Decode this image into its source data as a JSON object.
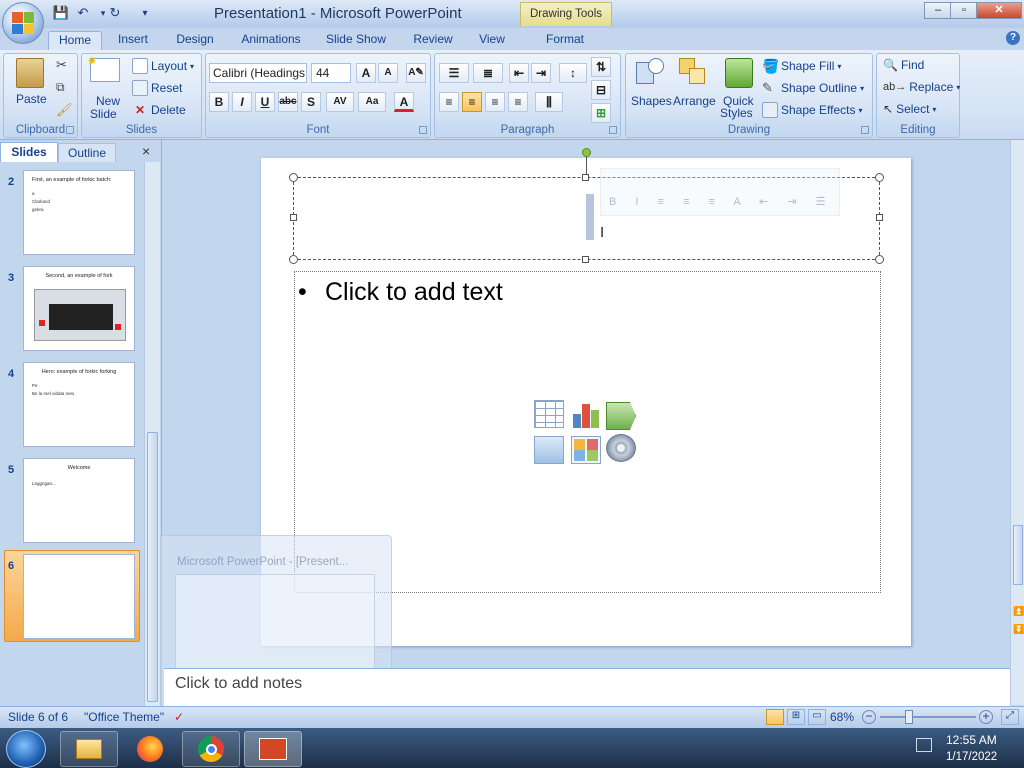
{
  "window": {
    "title": "Presentation1 - Microsoft PowerPoint",
    "contextual_tab": "Drawing Tools",
    "controls": [
      "–",
      "▫",
      "✕"
    ]
  },
  "quick_access": [
    "save",
    "undo",
    "redo"
  ],
  "tabs": [
    "Home",
    "Insert",
    "Design",
    "Animations",
    "Slide Show",
    "Review",
    "View",
    "Format"
  ],
  "ribbon": {
    "clipboard": {
      "label": "Clipboard",
      "paste": "Paste"
    },
    "slides": {
      "label": "Slides",
      "new_slide": "New",
      "new_slide2": "Slide",
      "layout": "Layout",
      "reset": "Reset",
      "delete": "Delete"
    },
    "font": {
      "label": "Font",
      "family": "Calibri (Headings",
      "size": "44"
    },
    "paragraph": {
      "label": "Paragraph"
    },
    "drawing": {
      "label": "Drawing",
      "shapes": "Shapes",
      "arrange": "Arrange",
      "quick_styles1": "Quick",
      "quick_styles2": "Styles",
      "shape_fill": "Shape Fill",
      "shape_outline": "Shape Outline",
      "shape_effects": "Shape Effects"
    },
    "editing": {
      "label": "Editing",
      "find": "Find",
      "replace": "Replace",
      "select": "Select"
    }
  },
  "left_pane": {
    "tabs": [
      "Slides",
      "Outline"
    ],
    "close": "×",
    "thumbnails": [
      {
        "num": "2",
        "title": "First, an example of forkic batch:",
        "lines": [
          "a",
          "Clarkand",
          "gebra"
        ]
      },
      {
        "num": "3",
        "title": "Second, an example of fork",
        "lines": []
      },
      {
        "num": "4",
        "title": "Hero: example of forkic forking",
        "lines": [
          "Pe",
          "Be la mel oidata rees"
        ]
      },
      {
        "num": "5",
        "title": "Welcome",
        "lines": [
          "Leggngan..."
        ]
      },
      {
        "num": "6",
        "title": "",
        "lines": []
      }
    ]
  },
  "slide": {
    "body_placeholder": "Click to add text",
    "bullet": "•"
  },
  "notes": {
    "placeholder": "Click to add notes"
  },
  "status": {
    "slide_info": "Slide 6 of 6",
    "theme": "\"Office Theme\"",
    "zoom": "68%"
  },
  "taskbar": {
    "time": "12:55 AM",
    "date": "1/17/2022",
    "ghost_title": "Microsoft PowerPoint - [Present..."
  },
  "colors": {
    "accent": "#15428b",
    "ribbon": "#dbe7f6",
    "selected_thumb": "#f7a84a"
  }
}
